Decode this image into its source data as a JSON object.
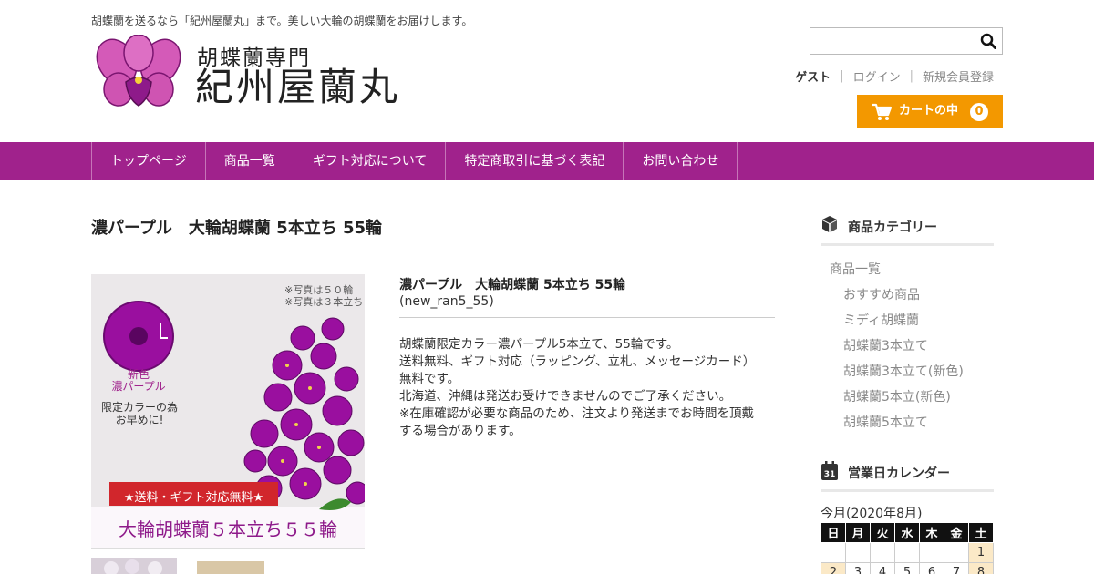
{
  "header": {
    "tagline": "胡蝶蘭を送るなら「紀州屋蘭丸」まで。美しい大輪の胡蝶蘭をお届けします。",
    "logo_subtitle": "胡蝶蘭専門",
    "logo_title": "紀州屋蘭丸",
    "search": {
      "value": "",
      "placeholder": ""
    },
    "user": {
      "guest": "ゲスト",
      "login": "ログイン",
      "register": "新規会員登録"
    },
    "cart": {
      "label": "カートの中",
      "count": "0"
    }
  },
  "nav": {
    "items": [
      "トップページ",
      "商品一覧",
      "ギフト対応について",
      "特定商取引に基づく表記",
      "お問い合わせ"
    ]
  },
  "product": {
    "title": "濃パープル　大輪胡蝶蘭 5本立ち 55輪",
    "name": "濃パープル　大輪胡蝶蘭 5本立ち 55輪",
    "code": "(new_ran5_55)",
    "description": [
      "胡蝶蘭限定カラー濃パープル5本立て、55輪です。",
      "送料無料、ギフト対応（ラッピング、立札、メッセージカード）",
      "無料です。",
      "北海道、沖縄は発送お受けできませんのでご了承ください。",
      "※在庫確認が必要な商品のため、注文より発送までお時間を頂戴",
      "する場合があります。"
    ],
    "image": {
      "note1": "※写真は５０輪",
      "note2": "※写真は３本立ち",
      "badge_line1": "新色",
      "badge_line2": "濃パープル",
      "limited_line1": "限定カラーの為",
      "limited_line2": "お早めに!",
      "ribbon": "★送料・ギフト対応無料★",
      "caption": "大輪胡蝶蘭５本立ち５５輪"
    }
  },
  "sidebar": {
    "categories_title": "商品カテゴリー",
    "categories": [
      {
        "label": "商品一覧",
        "sub": false
      },
      {
        "label": "おすすめ商品",
        "sub": true
      },
      {
        "label": "ミディ胡蝶蘭",
        "sub": true
      },
      {
        "label": "胡蝶蘭3本立て",
        "sub": true
      },
      {
        "label": "胡蝶蘭3本立て(新色)",
        "sub": true
      },
      {
        "label": "胡蝶蘭5本立(新色)",
        "sub": true
      },
      {
        "label": "胡蝶蘭5本立て",
        "sub": true
      }
    ],
    "calendar_title": "営業日カレンダー",
    "calendar_icon_number": "31",
    "calendar": {
      "month_label": "今月(2020年8月)",
      "weekdays": [
        "日",
        "月",
        "火",
        "水",
        "木",
        "金",
        "土"
      ],
      "rows": [
        [
          "",
          "",
          "",
          "",
          "",
          "",
          "1"
        ],
        [
          "2",
          "3",
          "4",
          "5",
          "6",
          "7",
          "8"
        ]
      ],
      "highlight_color": "#fbe9c7"
    }
  },
  "colors": {
    "nav_bg": "#a0228c",
    "cart_bg": "#f39800",
    "orchid": "#8e1a8a"
  }
}
